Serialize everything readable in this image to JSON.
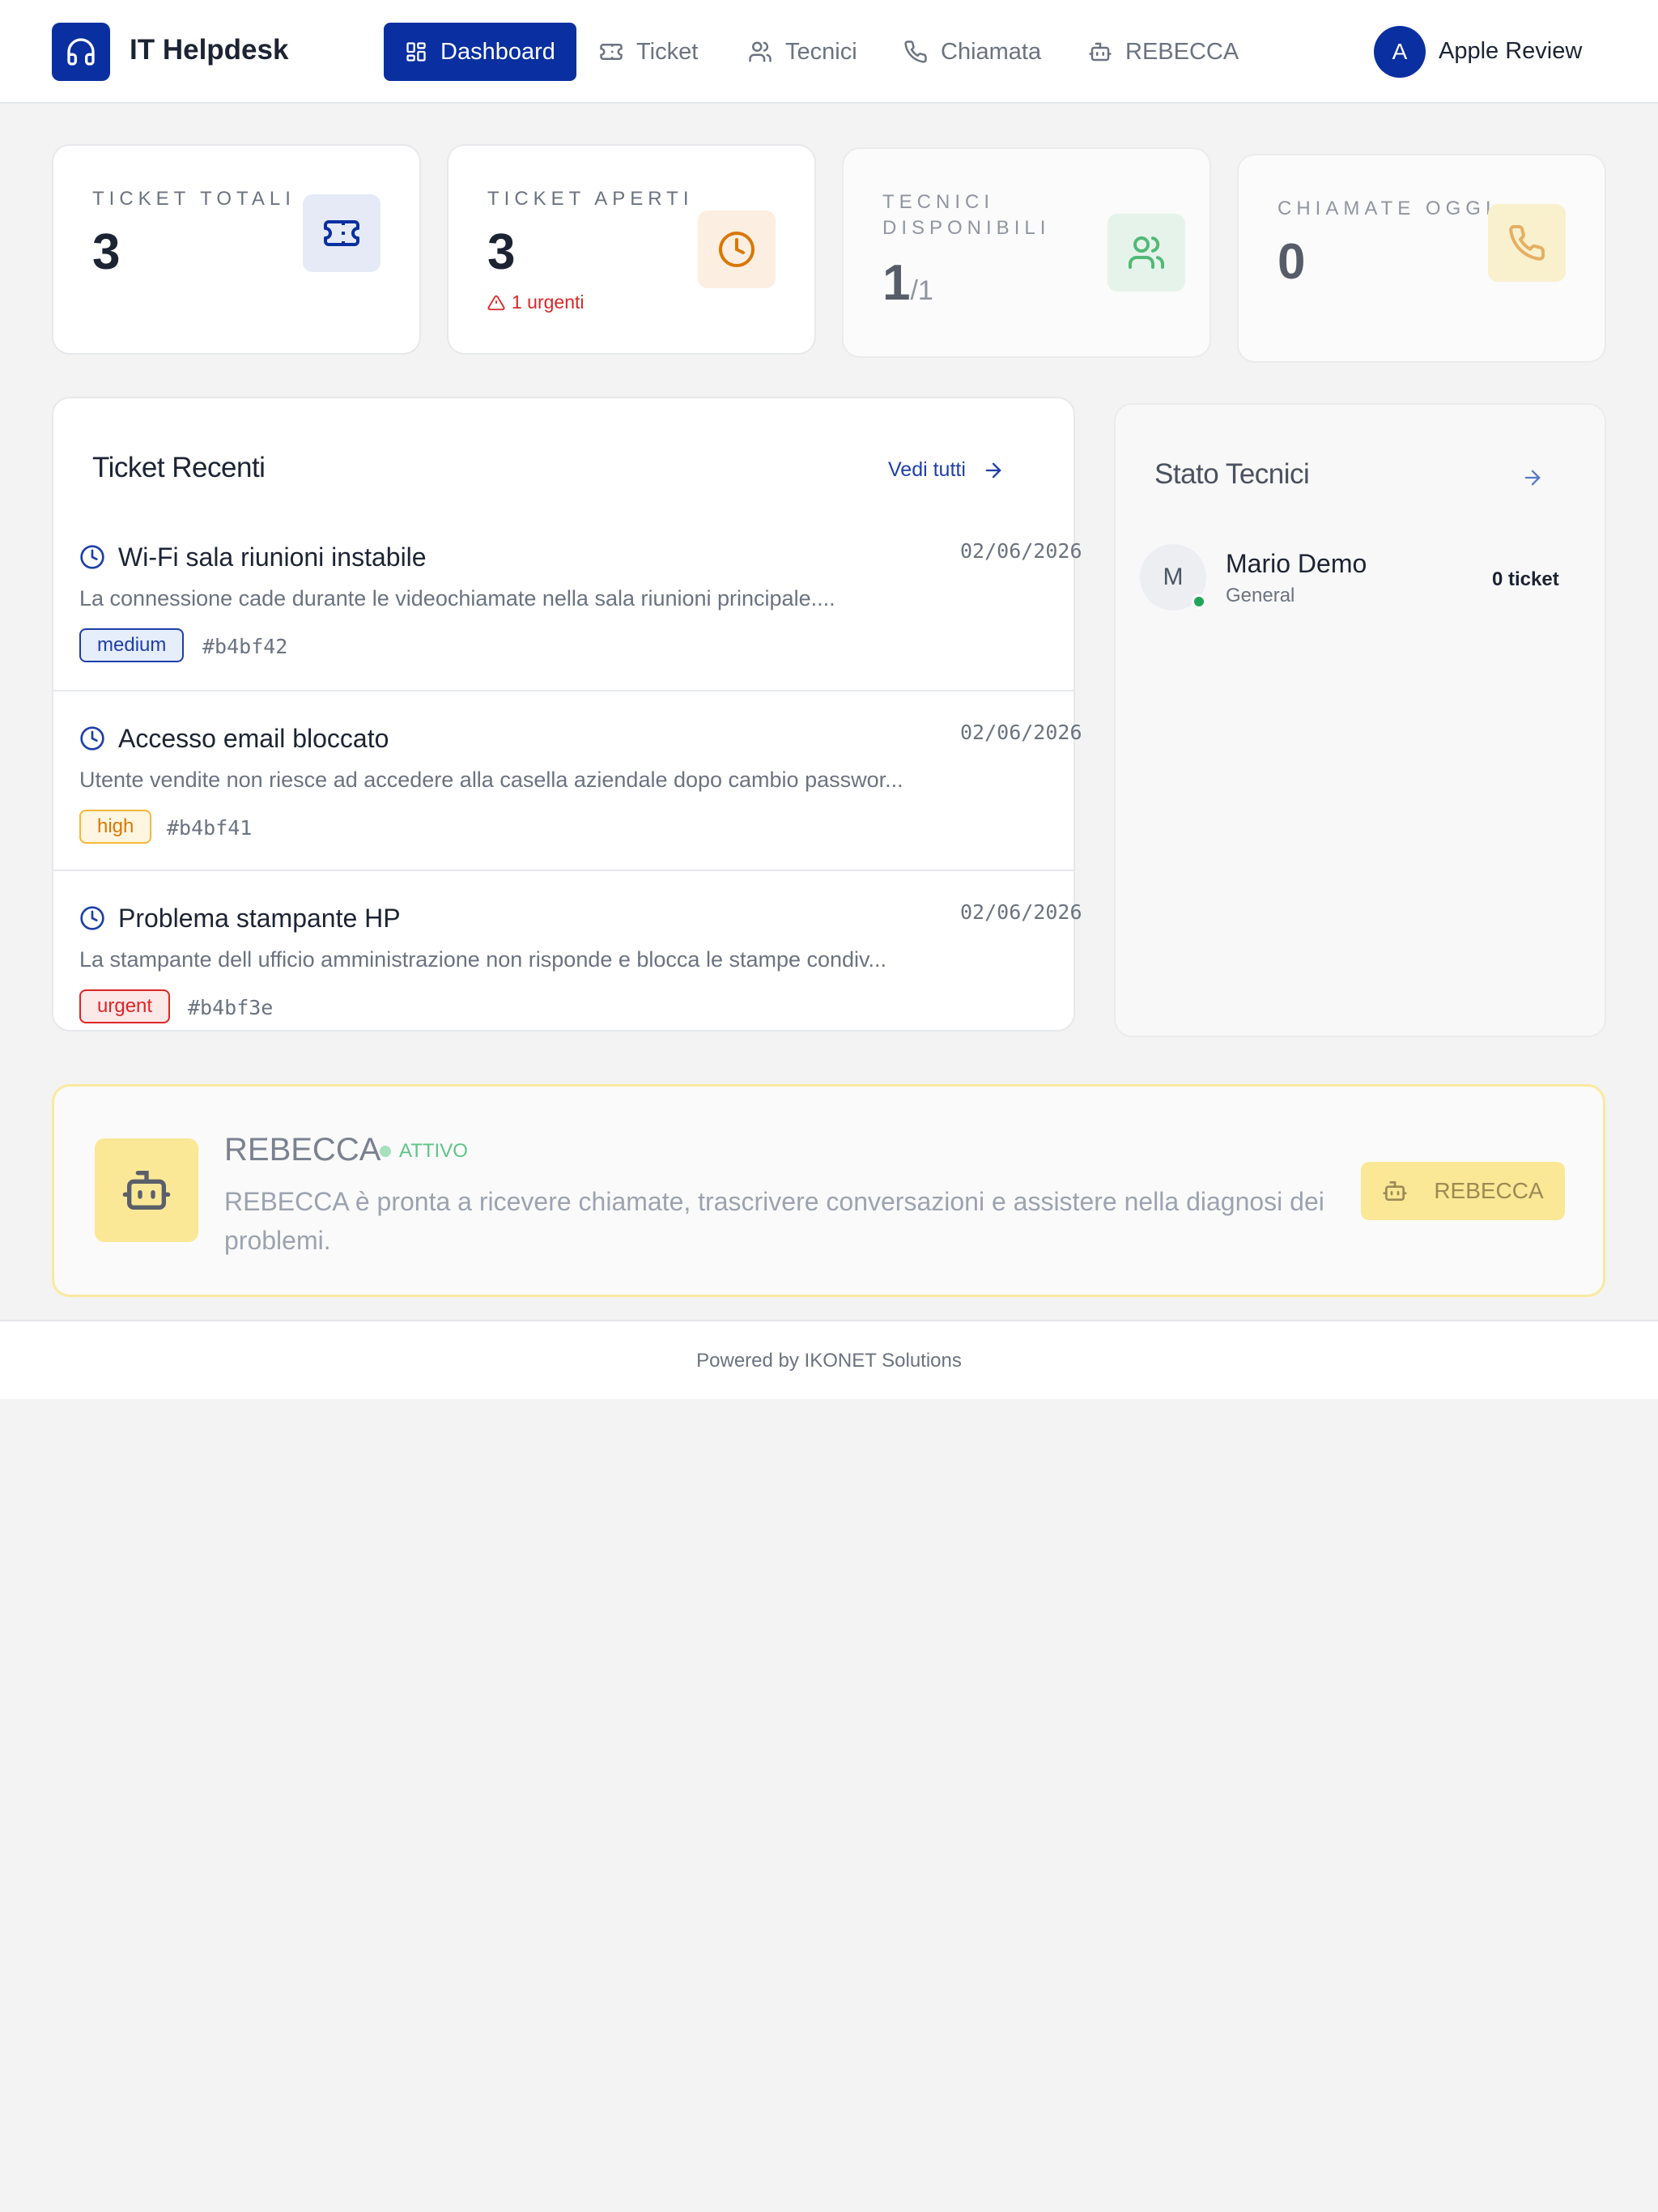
{
  "header": {
    "app_title": "IT Helpdesk",
    "nav": [
      {
        "label": "Dashboard",
        "icon": "dashboard-icon",
        "active": true
      },
      {
        "label": "Ticket",
        "icon": "ticket-icon"
      },
      {
        "label": "Tecnici",
        "icon": "users-icon"
      },
      {
        "label": "Chiamata",
        "icon": "phone-icon"
      },
      {
        "label": "REBECCA",
        "icon": "bot-icon"
      }
    ],
    "user": {
      "initial": "A",
      "name": "Apple Review"
    }
  },
  "stats": {
    "ticket_totali": {
      "label": "TICKET TOTALI",
      "value": "3"
    },
    "ticket_aperti": {
      "label": "TICKET APERTI",
      "value": "3",
      "sub": "1 urgenti"
    },
    "tecnici": {
      "label": "TECNICI DISPONIBILI",
      "value": "1",
      "total": "/1"
    },
    "chiamate": {
      "label": "CHIAMATE OGGI",
      "value": "0"
    }
  },
  "recent": {
    "title": "Ticket Recenti",
    "see_all": "Vedi tutti",
    "tickets": [
      {
        "title": "Wi-Fi sala riunioni instabile",
        "date": "02/06/2026",
        "desc": "La connessione cade durante le videochiamate nella sala riunioni principale....",
        "priority": "medium",
        "id": "#b4bf42"
      },
      {
        "title": "Accesso email bloccato",
        "date": "02/06/2026",
        "desc": "Utente vendite non riesce ad accedere alla casella aziendale dopo cambio passwor...",
        "priority": "high",
        "id": "#b4bf41"
      },
      {
        "title": "Problema stampante HP",
        "date": "02/06/2026",
        "desc": "La stampante dell ufficio amministrazione non risponde e blocca le stampe condiv...",
        "priority": "urgent",
        "id": "#b4bf3e"
      }
    ]
  },
  "technicians": {
    "title": "Stato Tecnici",
    "list": [
      {
        "initial": "M",
        "name": "Mario Demo",
        "role": "General",
        "tickets": "0 ticket",
        "online": true
      }
    ]
  },
  "rebecca": {
    "title": "REBECCA",
    "status": "ATTIVO",
    "description": "REBECCA è pronta a ricevere chiamate, trascrivere conversazioni e assistere nella diagnosi dei problemi.",
    "button": "REBECCA"
  },
  "footer": {
    "text": "Powered by IKONET Solutions"
  },
  "colors": {
    "brand": "#0a2fa0",
    "urgent": "#dc2626",
    "high": "#d97706",
    "medium": "#1e3fa8",
    "online": "#22a55a"
  }
}
